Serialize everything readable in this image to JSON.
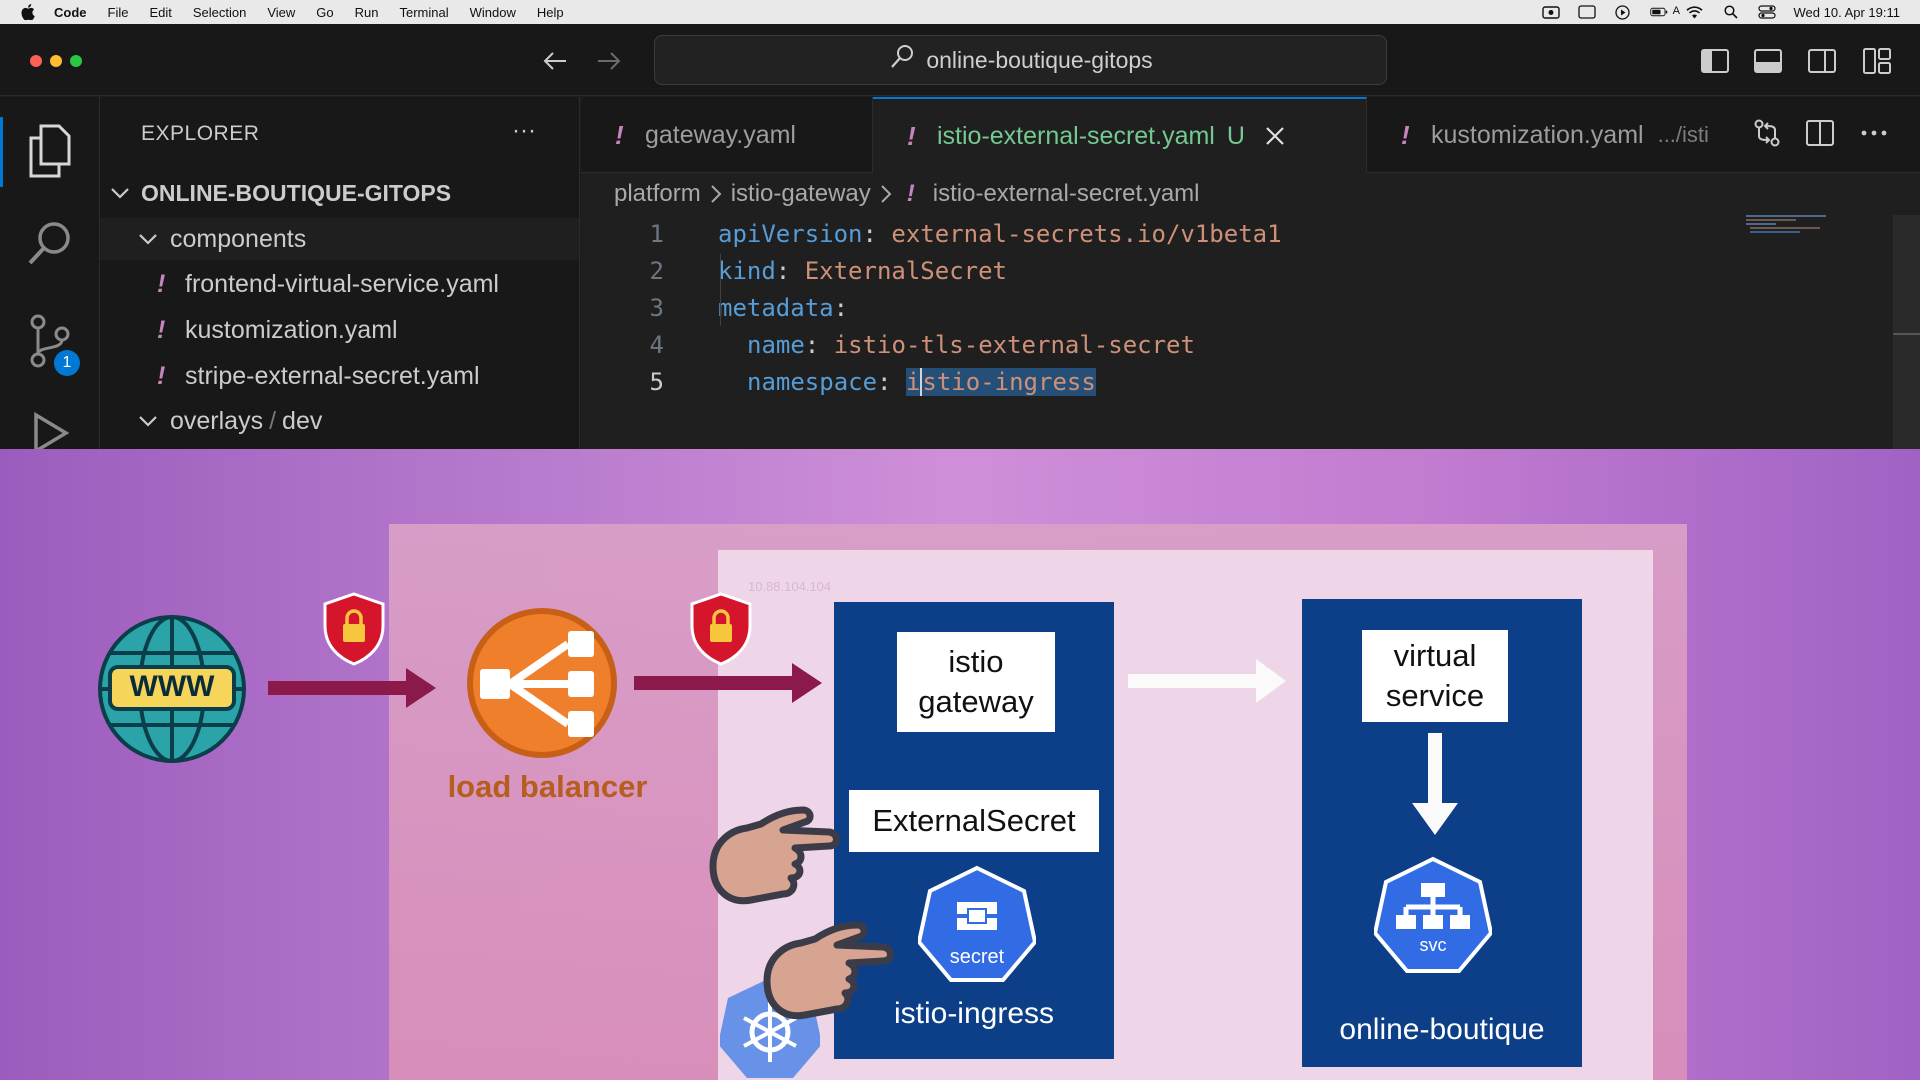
{
  "menubar": {
    "app_name": "Code",
    "items": [
      "File",
      "Edit",
      "Selection",
      "View",
      "Go",
      "Run",
      "Terminal",
      "Window",
      "Help"
    ],
    "input_indicator": "A",
    "clock": "Wed 10. Apr  19:11"
  },
  "titlebar": {
    "search_text": "online-boutique-gitops"
  },
  "activitybar": {
    "scm_badge": "1"
  },
  "sidebar": {
    "title": "EXPLORER",
    "more": "···",
    "root": "ONLINE-BOUTIQUE-GITOPS",
    "folder_components": "components",
    "files": [
      {
        "bang": "!",
        "name": "frontend-virtual-service.yaml"
      },
      {
        "bang": "!",
        "name": "kustomization.yaml"
      },
      {
        "bang": "!",
        "name": "stripe-external-secret.yaml"
      }
    ],
    "folder_overlays": "overlays",
    "folder_overlays_sub": "dev",
    "path_sep": "/"
  },
  "tabs": [
    {
      "bang": "!",
      "label": "gateway.yaml",
      "extra": ""
    },
    {
      "bang": "!",
      "label": "istio-external-secret.yaml",
      "extra": "U"
    },
    {
      "bang": "!",
      "label": "kustomization.yaml",
      "extra": ".../isti"
    }
  ],
  "breadcrumb": {
    "parts": [
      "platform",
      "istio-gateway"
    ],
    "bang": "!",
    "file": "istio-external-secret.yaml"
  },
  "code": {
    "line_numbers": [
      "1",
      "2",
      "3",
      "4",
      "5"
    ],
    "l1_key": "apiVersion",
    "l1_val": "external-secrets.io/v1beta1",
    "l2_key": "kind",
    "l2_val": "ExternalSecret",
    "l3_key": "metadata",
    "l4_key": "name",
    "l4_val": "istio-tls-external-secret",
    "l5_key": "namespace",
    "l5_val_first": "i",
    "l5_val_rest": "stio-ingress",
    "colon": ":"
  },
  "diagram": {
    "ip_text": "10.88.104.104",
    "www_label": "WWW",
    "lb_label": "load balancer",
    "istio_gateway_label": "istio\ngateway",
    "external_secret_label": "ExternalSecret",
    "secret_icon_label": "secret",
    "ns1_label": "istio-ingress",
    "virtual_service_label": "virtual\nservice",
    "svc_icon_label": "svc",
    "ns2_label": "online-boutique"
  },
  "colors": {
    "accent": "#0078d4",
    "yaml_key": "#569cd6",
    "yaml_value": "#ce9178",
    "git_untracked": "#73c991",
    "namespace_blue": "#0c3f87",
    "arrow_crimson": "#8b1a4b",
    "lb_orange": "#f07f2c"
  }
}
